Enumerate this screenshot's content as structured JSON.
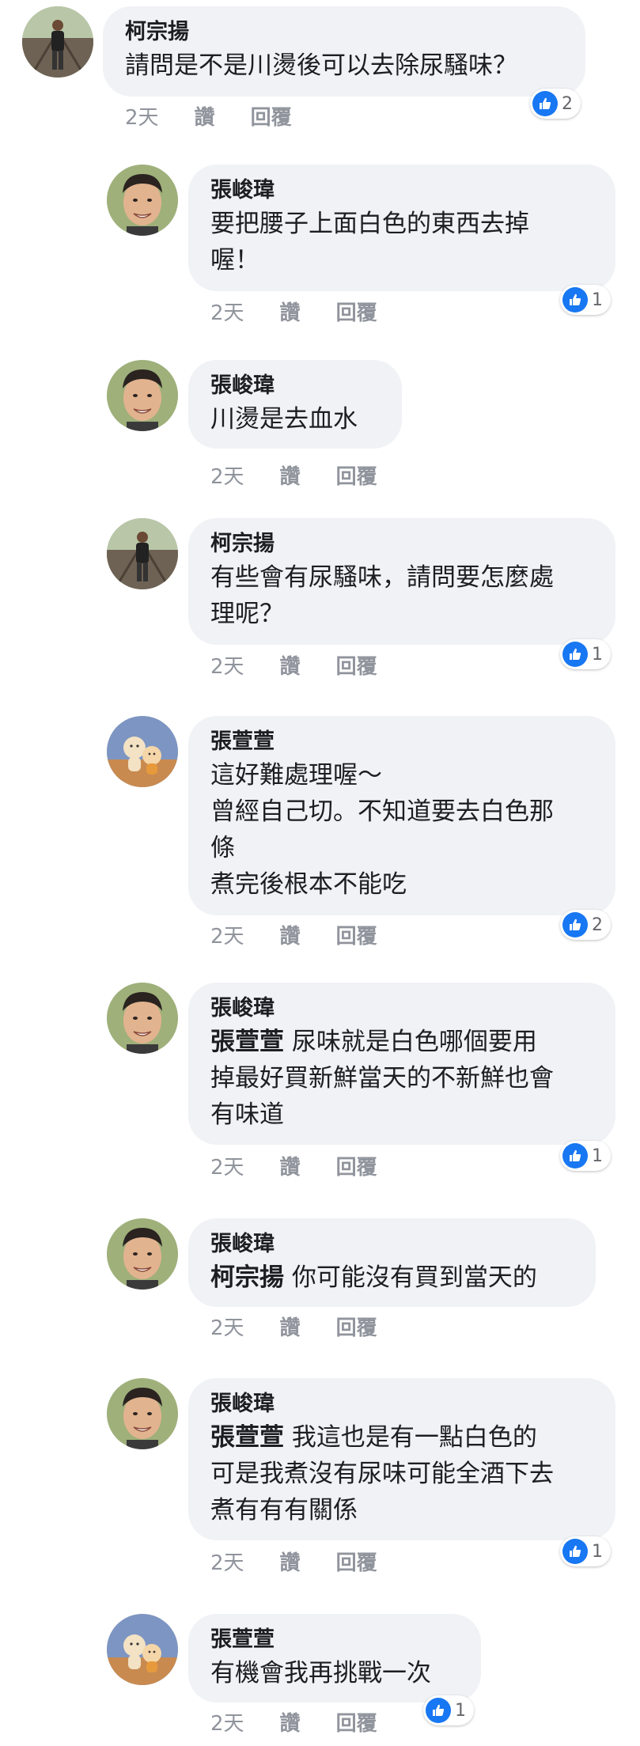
{
  "colors": {
    "bubble": "#f0f2f5",
    "meta": "#90949c",
    "like": "#1877f2"
  },
  "comments": [
    {
      "author": "柯宗揚",
      "avatar": "man-on-railroad-avatar",
      "lines": [
        "請問是不是川燙後可以去除尿騷味？"
      ],
      "time": "2天",
      "like": "讚",
      "reply": "回覆",
      "reactions": "2"
    },
    {
      "author": "張峻瑋",
      "avatar": "smiling-man-avatar",
      "lines": [
        "要把腰子上面白色的東西去掉",
        "喔！"
      ],
      "time": "2天",
      "like": "讚",
      "reply": "回覆",
      "reactions": "1"
    },
    {
      "author": "張峻瑋",
      "avatar": "smiling-man-avatar",
      "lines": [
        "川燙是去血水"
      ],
      "time": "2天",
      "like": "讚",
      "reply": "回覆"
    },
    {
      "author": "柯宗揚",
      "avatar": "man-on-railroad-avatar",
      "lines": [
        "有些會有尿騷味，請問要怎麼處",
        "理呢？"
      ],
      "time": "2天",
      "like": "讚",
      "reply": "回覆",
      "reactions": "1"
    },
    {
      "author": "張萱萱",
      "avatar": "toy-figures-avatar",
      "lines": [
        "這好難處理喔～",
        "曾經自己切。不知道要去白色那",
        "條",
        "煮完後根本不能吃"
      ],
      "time": "2天",
      "like": "讚",
      "reply": "回覆",
      "reactions": "2"
    },
    {
      "author": "張峻瑋",
      "avatar": "smiling-man-avatar",
      "mention": "張萱萱",
      "lines": [
        " 尿味就是白色哪個要用",
        "掉最好買新鮮當天的不新鮮也會",
        "有味道"
      ],
      "time": "2天",
      "like": "讚",
      "reply": "回覆",
      "reactions": "1"
    },
    {
      "author": "張峻瑋",
      "avatar": "smiling-man-avatar",
      "mention": "柯宗揚",
      "lines": [
        " 你可能沒有買到當天的"
      ],
      "time": "2天",
      "like": "讚",
      "reply": "回覆"
    },
    {
      "author": "張峻瑋",
      "avatar": "smiling-man-avatar",
      "mention": "張萱萱",
      "lines": [
        " 我這也是有一點白色的",
        "可是我煮沒有尿味可能全酒下去",
        "煮有有有關係"
      ],
      "time": "2天",
      "like": "讚",
      "reply": "回覆",
      "reactions": "1"
    },
    {
      "author": "張萱萱",
      "avatar": "toy-figures-avatar",
      "lines": [
        "有機會我再挑戰一次"
      ],
      "time": "2天",
      "like": "讚",
      "reply": "回覆",
      "reactions": "1"
    }
  ]
}
